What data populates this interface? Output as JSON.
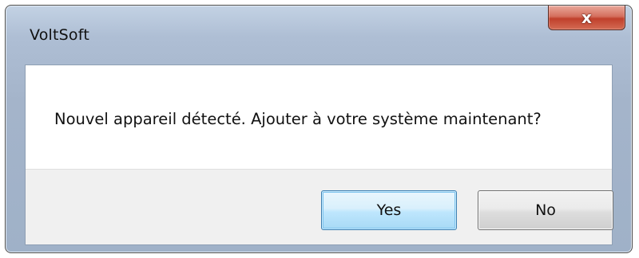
{
  "window": {
    "title": "VoltSoft",
    "close_glyph": "x"
  },
  "dialog": {
    "message": "Nouvel appareil détecté. Ajouter à votre système maintenant?",
    "buttons": {
      "yes": "Yes",
      "no": "No"
    }
  }
}
